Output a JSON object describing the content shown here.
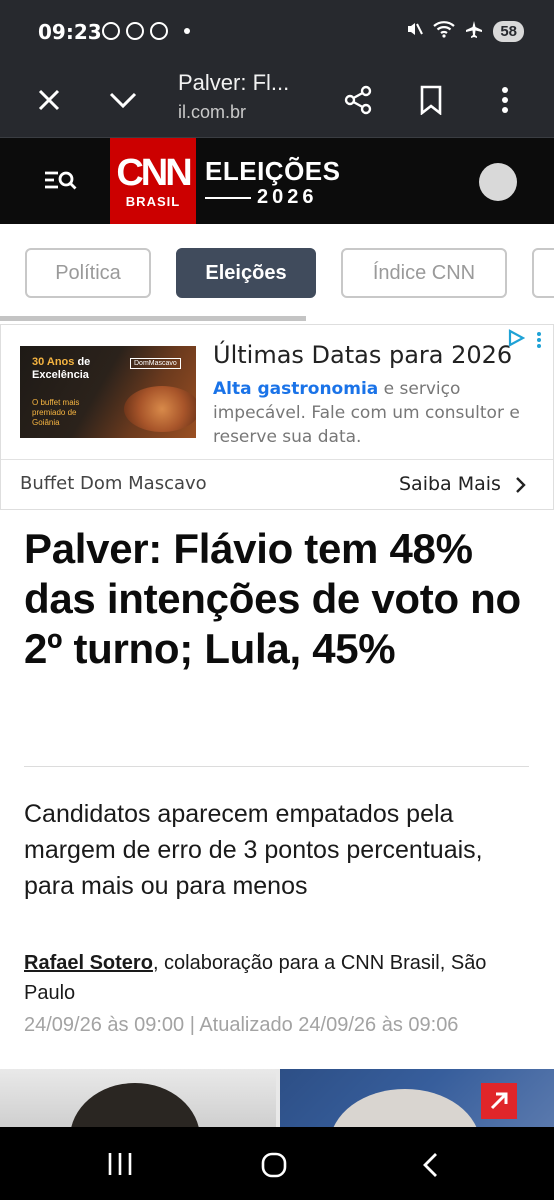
{
  "status_bar": {
    "time": "09:23",
    "battery": "58",
    "icons": [
      "whatsapp-icon",
      "chat-icon",
      "chrome-icon",
      "dot-icon",
      "mute-icon",
      "wifi-icon",
      "airplane-icon"
    ]
  },
  "browser": {
    "title": "Palver: Fl...",
    "url": "il.com.br",
    "icons": [
      "close-icon",
      "chevron-down-icon",
      "share-icon",
      "bookmark-icon",
      "more-vert-icon"
    ]
  },
  "site_header": {
    "logo_top": "CNN",
    "logo_bottom": "BRASIL",
    "section_title": "ELEIÇÕES",
    "section_year": "2026"
  },
  "tabs": [
    {
      "label": "Política",
      "active": false
    },
    {
      "label": "Eleições",
      "active": true
    },
    {
      "label": "Índice CNN",
      "active": false
    },
    {
      "label": "",
      "active": false
    }
  ],
  "ad": {
    "image_text_1a": "30 Anos",
    "image_text_1b": "de",
    "image_text_2": "Excelência",
    "image_text_3": "O buffet mais",
    "image_text_4": "premiado de",
    "image_text_5": "Goiânia",
    "image_brand": "DomMascavo",
    "headline": "Últimas Datas para 2026",
    "body_highlight": "Alta gastronomia",
    "body_text": " e serviço impecável. Fale com um consultor e reserve sua data.",
    "advertiser": "Buffet Dom Mascavo",
    "cta": "Saiba Mais"
  },
  "article": {
    "headline": "Palver: Flávio tem 48% das intenções de voto no 2º turno; Lula, 45%",
    "subheadline": "Candidatos aparecem empatados pela margem de erro de 3 pontos percentuais, para mais ou para menos",
    "author": "Rafael Sotero",
    "byline_rest": ", colaboração para a CNN Brasil, São Paulo",
    "dateline": "24/09/26 às 09:00 | Atualizado 24/09/26 às 09:06"
  },
  "colors": {
    "cnn_red": "#cc0000",
    "active_tab": "#404b5c",
    "ad_link": "#1a73e8",
    "expand_button": "#e0262a"
  }
}
